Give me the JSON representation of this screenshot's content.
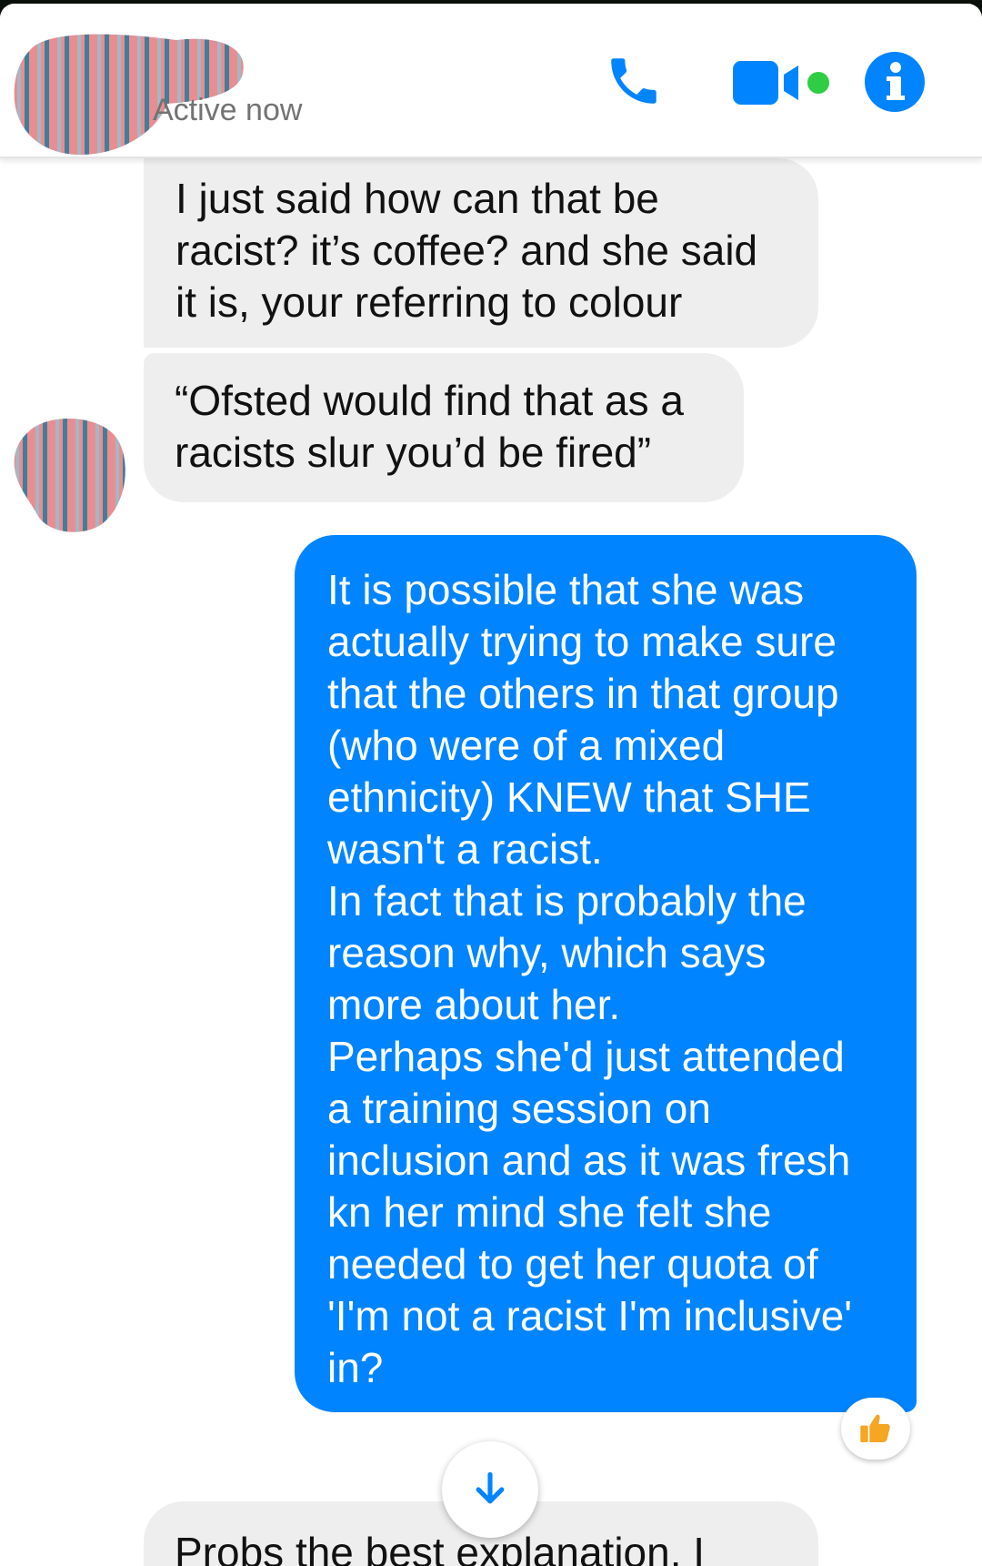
{
  "header": {
    "status": "Active now",
    "icons": [
      "phone-icon",
      "video-call-icon",
      "info-icon"
    ],
    "accent_color": "#0084ff",
    "online_color": "#31cc46"
  },
  "messages": [
    {
      "direction": "incoming",
      "lines": [
        "I just said how can that be",
        "racist? it’s coffee? and she said",
        "it is, your referring to colour"
      ]
    },
    {
      "direction": "incoming",
      "lines": [
        "“Ofsted would find that as a",
        "racists slur you’d be fired”"
      ]
    },
    {
      "direction": "outgoing",
      "lines": [
        "It is possible that she was",
        "actually trying to make sure",
        "that the others in that group",
        "(who were of a mixed",
        "ethnicity) KNEW that SHE",
        "wasn't a racist.",
        "In fact that is probably the",
        "reason why, which says",
        "more about her.",
        "Perhaps she'd just attended",
        "a training session on",
        "inclusion and as it was fresh",
        "kn her mind she felt she",
        "needed to get her quota of",
        "'I'm not a racist I'm inclusive'",
        "in?"
      ],
      "reaction": "thumbs-up-icon"
    },
    {
      "direction": "incoming",
      "lines": [
        "Probs the best explanation. I"
      ]
    }
  ],
  "scroll_button": "arrow-down-icon"
}
